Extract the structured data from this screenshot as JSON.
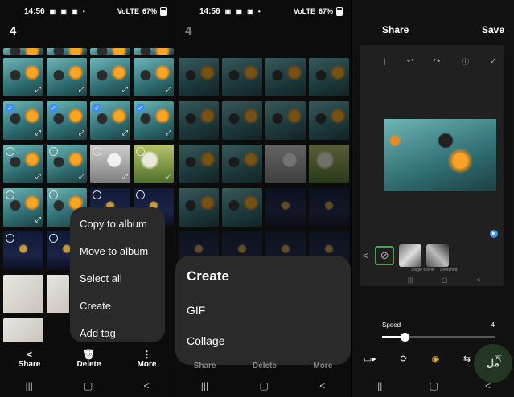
{
  "status": {
    "time": "14:56",
    "notifications": "▣ ▣ ▣ •",
    "signal": "VoLTE",
    "battery": "67%"
  },
  "panel1": {
    "selected_count": "4",
    "menu": [
      "Copy to album",
      "Move to album",
      "Select all",
      "Create",
      "Add tag"
    ],
    "bottom": {
      "share": "Share",
      "delete": "Delete",
      "more": "More"
    }
  },
  "panel2": {
    "selected_count": "4",
    "sheet": {
      "title": "Create",
      "options": [
        "GIF",
        "Collage"
      ]
    },
    "bottom": {
      "share": "Share",
      "delete": "Delete",
      "more": "More"
    }
  },
  "panel3": {
    "share": "Share",
    "save": "Save",
    "filters": [
      "Single scene",
      "Stretched"
    ],
    "speed_label": "Speed",
    "speed_value": "4",
    "speed_fraction": 0.2,
    "watermark": "مل"
  },
  "icons": {
    "share": "share-icon",
    "delete": "trash-icon",
    "more": "more-vertical-icon",
    "recents": "recent-apps-icon",
    "home": "home-icon",
    "back": "back-icon"
  }
}
